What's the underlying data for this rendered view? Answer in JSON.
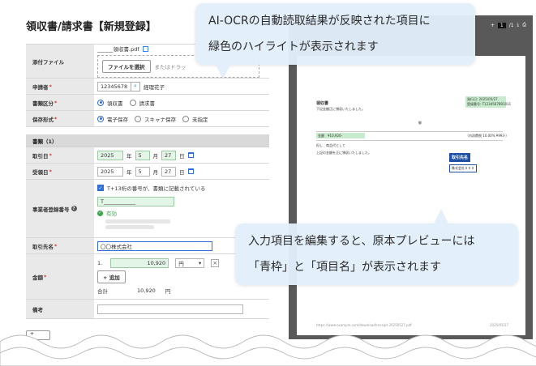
{
  "form": {
    "title": "領収書/請求書【新規登録】",
    "rows": {
      "file": {
        "label": "添付ファイル",
        "filename": "______領収書.pdf",
        "choose": "ファイルを選択",
        "drop_hint": "またはドラッ"
      },
      "applicant": {
        "label": "申請者",
        "id": "12345678",
        "name": "経理花子"
      },
      "doc_type": {
        "label": "書類区分",
        "opt1": "領収書",
        "opt2": "請求書"
      },
      "storage": {
        "label": "保存形式",
        "opt1": "電子保存",
        "opt2": "スキャナ保存",
        "opt3": "未指定"
      },
      "section": "書類（1）",
      "trade_date": {
        "label": "取引日",
        "year": "2025",
        "year_unit": "年",
        "month": "5",
        "month_unit": "月",
        "day": "27",
        "day_unit": "日"
      },
      "receive_date": {
        "label": "受領日",
        "year": "2025",
        "year_unit": "年",
        "month": "5",
        "month_unit": "月",
        "day": "27",
        "day_unit": "日"
      },
      "reg_no": {
        "label": "事業者登録番号",
        "check": "T+13桁の番号が、書類に記載されている",
        "value": "T____________",
        "status": "有効"
      },
      "partner": {
        "label": "取引先名",
        "value": "〇〇株式会社"
      },
      "amount": {
        "label": "金額",
        "index": "1.",
        "value": "10,920",
        "currency": "円",
        "add": "追加",
        "total_label": "合計",
        "total_value": "10,920",
        "total_unit": "円"
      },
      "note": {
        "label": "備考"
      }
    },
    "required_mark": "*",
    "bottom_button": "+"
  },
  "preview": {
    "page_current": "1",
    "page_total": "/1",
    "doc_title": "領収書",
    "doc_sub": "下記金額正に領収いたしました。",
    "issue_date": "発行日: 2025/05/27",
    "reg_no": "登録番号: T1234567891011",
    "amount": "金額　¥10,920-",
    "tax_note": "（内消費税 10.00%  ¥993-）",
    "item": "但し　商品代として",
    "stamp": "上記の金額を正に領収いたしました。",
    "tag": "取引先名",
    "tag_value": "株式会社ＸＸＸ",
    "footer_url": "https://www.example.com/download/receipt-20250527.pdf",
    "footer_date": "2025/05/27"
  },
  "callouts": {
    "top_line1": "AI-OCRの自動読取結果が反映された項目に",
    "top_line2": "緑色のハイライトが表示されます",
    "bottom_line1": "入力項目を編集すると、原本プレビューには",
    "bottom_line2": "「青枠」と「項目名」が表示されます"
  },
  "colors": {
    "highlight_green": "#c8ebcd",
    "accent_blue": "#2f6fd6",
    "callout_bg": "#e2eefa",
    "preview_bg": "#595959"
  }
}
